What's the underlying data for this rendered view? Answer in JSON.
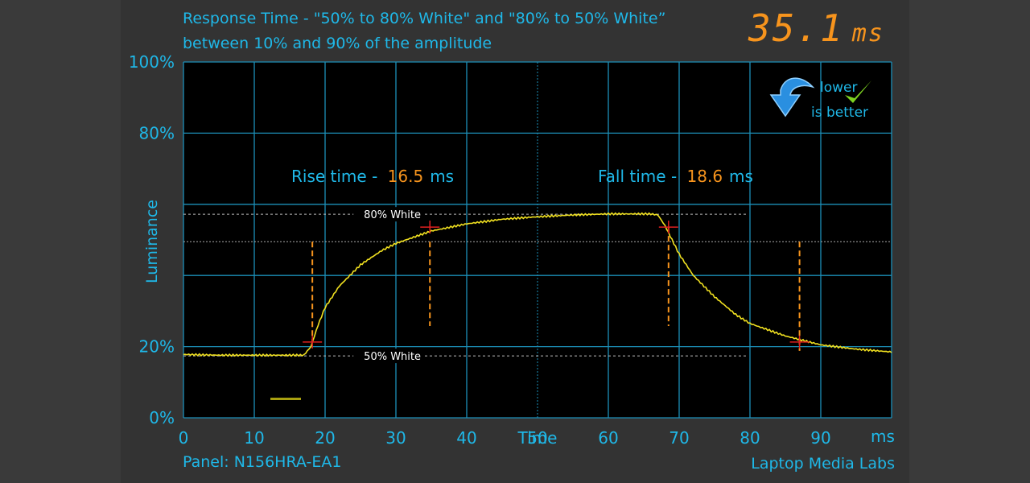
{
  "title_line1": "Response Time - \"50% to 80% White\" and \"80% to 50% White”",
  "title_line2": "between 10% and 90% of the amplitude",
  "total_value": "35.1",
  "total_unit": "ms",
  "badge": {
    "line1": "lower",
    "line2": "is better",
    "icons": [
      "blue-curved-arrow-down-icon",
      "green-checkmark-icon"
    ]
  },
  "panel_label": "Panel: N156HRA-EA1",
  "brand": "Laptop Media Labs",
  "colors": {
    "axis_text": "#1fb8e8",
    "grid": "#1c8fb8",
    "trace": "#f0e020",
    "highlight": "#f7941d",
    "marker": "#e02020"
  },
  "chart_data": {
    "type": "line",
    "xlabel": "Time",
    "ylabel": "Luminance",
    "x_unit": "ms",
    "xlim": [
      0,
      100
    ],
    "ylim": [
      0,
      100
    ],
    "x_ticks": [
      "0",
      "10",
      "20",
      "30",
      "40",
      "50",
      "60",
      "70",
      "80",
      "90"
    ],
    "y_ticks": [
      {
        "v": 100,
        "label": "100%"
      },
      {
        "v": 80,
        "label": "80%"
      },
      {
        "v": 20,
        "label": "20%"
      },
      {
        "v": 0,
        "label": "0%"
      }
    ],
    "grid": true,
    "annotations": {
      "rise_label": "Rise time - ",
      "rise_value": "16.5",
      "rise_unit": "ms",
      "fall_label": "Fall time - ",
      "fall_value": "18.6",
      "fall_unit": "ms",
      "level_high": {
        "label": "80% White",
        "y": 57.2
      },
      "level_low": {
        "label": "50% White",
        "y": 17.4
      },
      "markers": [
        {
          "x": 18.2,
          "y": 21.3
        },
        {
          "x": 34.8,
          "y": 53.6
        },
        {
          "x": 68.5,
          "y": 53.6
        },
        {
          "x": 87,
          "y": 21.3
        }
      ],
      "bracket_lines": [
        {
          "x": 18.2,
          "y1": 49.5,
          "y2": 21.3
        },
        {
          "x": 34.8,
          "y1": 49.5,
          "y2": 25.8
        },
        {
          "x": 68.5,
          "y1": 53.6,
          "y2": 25.8
        },
        {
          "x": 87,
          "y1": 49.5,
          "y2": 18.8
        }
      ]
    },
    "series": [
      {
        "points": [
          [
            0,
            17.8
          ],
          [
            5,
            17.6
          ],
          [
            10,
            17.6
          ],
          [
            17,
            17.6
          ],
          [
            18,
            20
          ],
          [
            19,
            26
          ],
          [
            20,
            31
          ],
          [
            22,
            37
          ],
          [
            25,
            43
          ],
          [
            28,
            47
          ],
          [
            30,
            49
          ],
          [
            35,
            52.5
          ],
          [
            40,
            54.5
          ],
          [
            45,
            55.8
          ],
          [
            50,
            56.5
          ],
          [
            55,
            57
          ],
          [
            60,
            57.3
          ],
          [
            66,
            57.3
          ],
          [
            67,
            57
          ],
          [
            68,
            54
          ],
          [
            69,
            50
          ],
          [
            70,
            46
          ],
          [
            72,
            40
          ],
          [
            75,
            34
          ],
          [
            78,
            29
          ],
          [
            80,
            26.5
          ],
          [
            85,
            23
          ],
          [
            90,
            20.5
          ],
          [
            95,
            19.3
          ],
          [
            100,
            18.5
          ]
        ]
      }
    ]
  }
}
